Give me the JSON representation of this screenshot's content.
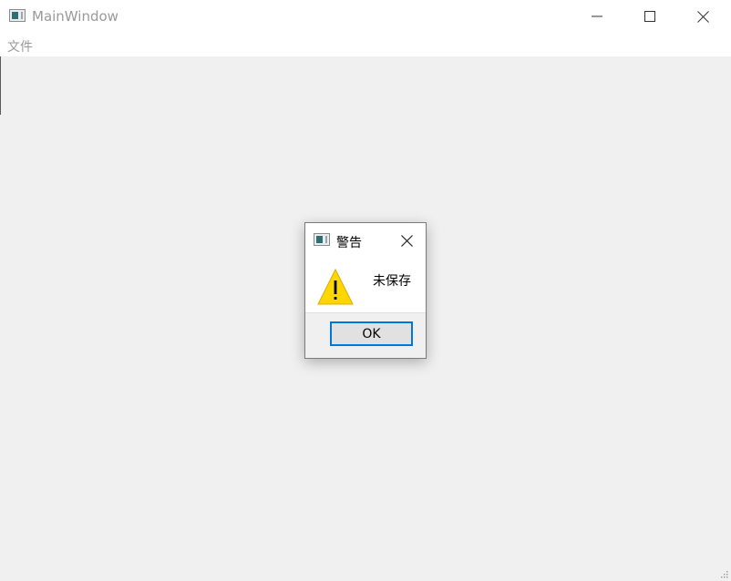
{
  "window": {
    "title": "MainWindow",
    "icon": "app-window-icon",
    "controls": [
      "minimize-icon",
      "maximize-icon",
      "close-icon"
    ]
  },
  "menubar": {
    "items": [
      {
        "label": "文件"
      }
    ]
  },
  "dialog": {
    "title": "警告",
    "icon": "app-window-icon",
    "message": "未保存",
    "message_icon": "warning-icon",
    "ok_label": "OK",
    "accent_color": "#0078d7",
    "warning_color": "#ffd700"
  }
}
